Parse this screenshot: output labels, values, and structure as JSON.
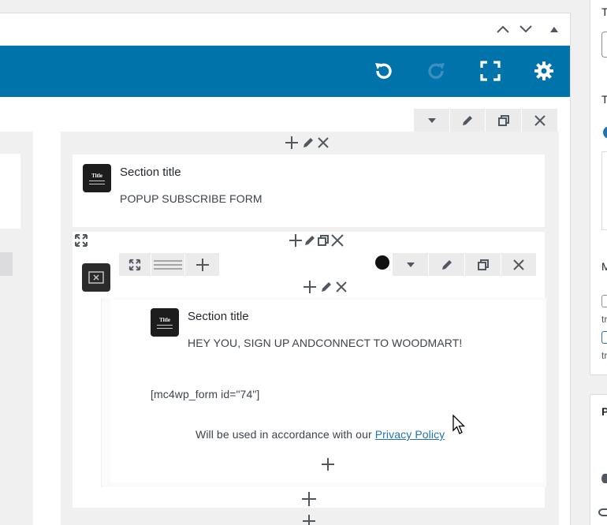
{
  "panel": {
    "header_controls": [
      "chevron-up",
      "chevron-down",
      "triangle-up"
    ]
  },
  "toolbar": {
    "accent": "#0073aa",
    "buttons": [
      "undo-icon",
      "redo-icon",
      "fullscreen-icon",
      "gear-icon"
    ]
  },
  "row1": {
    "title": "Section title",
    "text": "POPUP SUBSCRIBE FORM"
  },
  "row2": {
    "title": "Section title",
    "text": "HEY YOU, SIGN UP ANDCONNECT TO WOODMART!",
    "shortcode": "[mc4wp_form id=\"74\"]",
    "note_prefix": "Will be used in accordance with our",
    "note_link": "Privacy Policy"
  },
  "thumb_label": "Title",
  "sidebar": {
    "label_t1": "T",
    "label_t2": "T",
    "label_m": "M",
    "text_tr1": "tr",
    "text_tr2": "tr",
    "label_p": "P"
  }
}
